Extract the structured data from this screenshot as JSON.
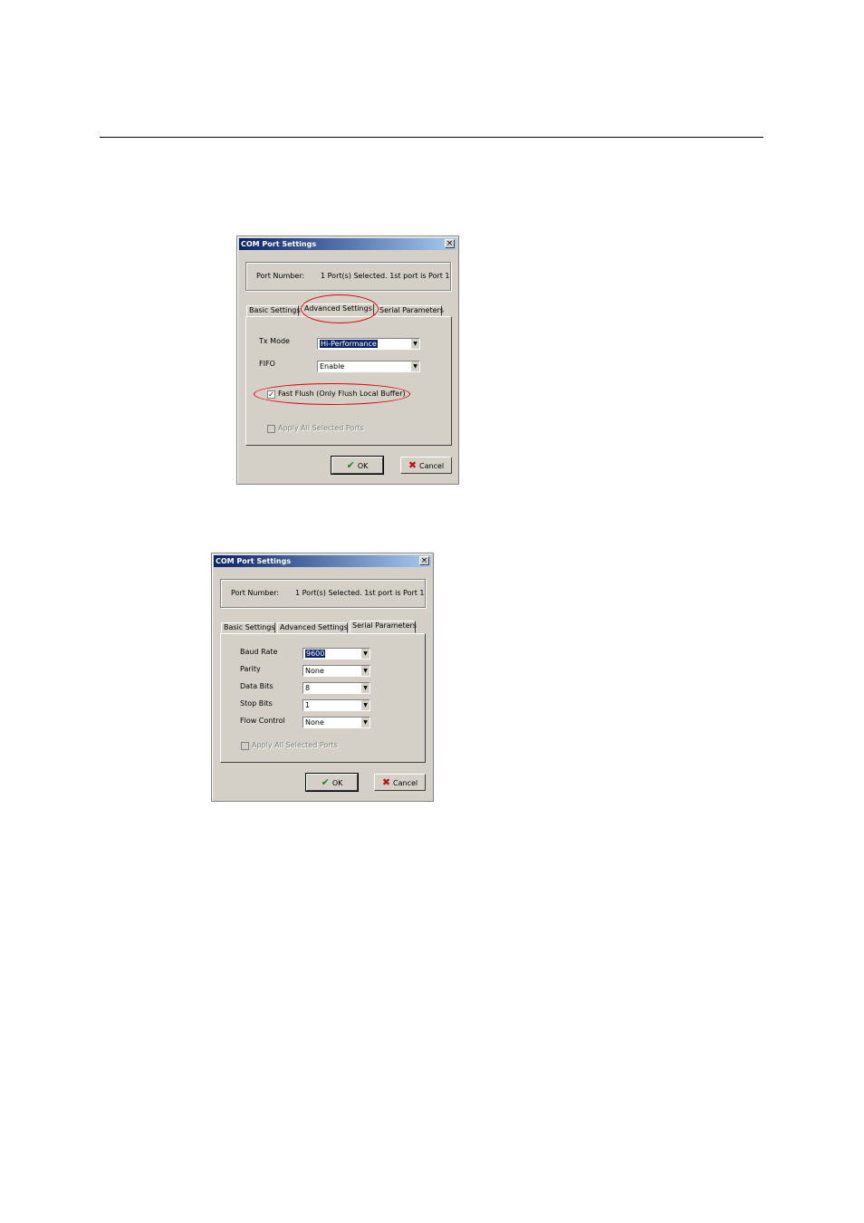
{
  "dialog_title": "COM Port Settings",
  "close_glyph": "×",
  "colors": {
    "annotation": "#e00000",
    "titlebar_start": "#0a246a",
    "titlebar_end": "#a6caf0"
  },
  "icons": {
    "ok": "checkmark-icon",
    "cancel": "x-icon"
  },
  "dialog1": {
    "port_number_label": "Port Number:",
    "port_number_value": "1 Port(s) Selected. 1st port is Port 1",
    "tabs": [
      "Basic Settings",
      "Advanced Settings",
      "Serial Parameters"
    ],
    "active_tab": "Advanced Settings",
    "tx_mode_label": "Tx Mode",
    "tx_mode_value": "Hi-Performance",
    "fifo_label": "FIFO",
    "fifo_value": "Enable",
    "fast_flush_label": "Fast Flush (Only Flush Local Buffer)",
    "fast_flush_checked": true,
    "apply_all_label": "Apply All Selected Ports",
    "ok_label": "OK",
    "cancel_label": "Cancel"
  },
  "dialog2": {
    "port_number_label": "Port Number:",
    "port_number_value": "1 Port(s) Selected. 1st port is Port 1",
    "tabs": [
      "Basic Settings",
      "Advanced Settings",
      "Serial Parameters"
    ],
    "active_tab": "Serial Parameters",
    "baud_rate_label": "Baud Rate",
    "baud_rate_value": "9600",
    "parity_label": "Parity",
    "parity_value": "None",
    "data_bits_label": "Data Bits",
    "data_bits_value": "8",
    "stop_bits_label": "Stop Bits",
    "stop_bits_value": "1",
    "flow_control_label": "Flow Control",
    "flow_control_value": "None",
    "apply_all_label": "Apply All Selected Ports",
    "ok_label": "OK",
    "cancel_label": "Cancel"
  }
}
